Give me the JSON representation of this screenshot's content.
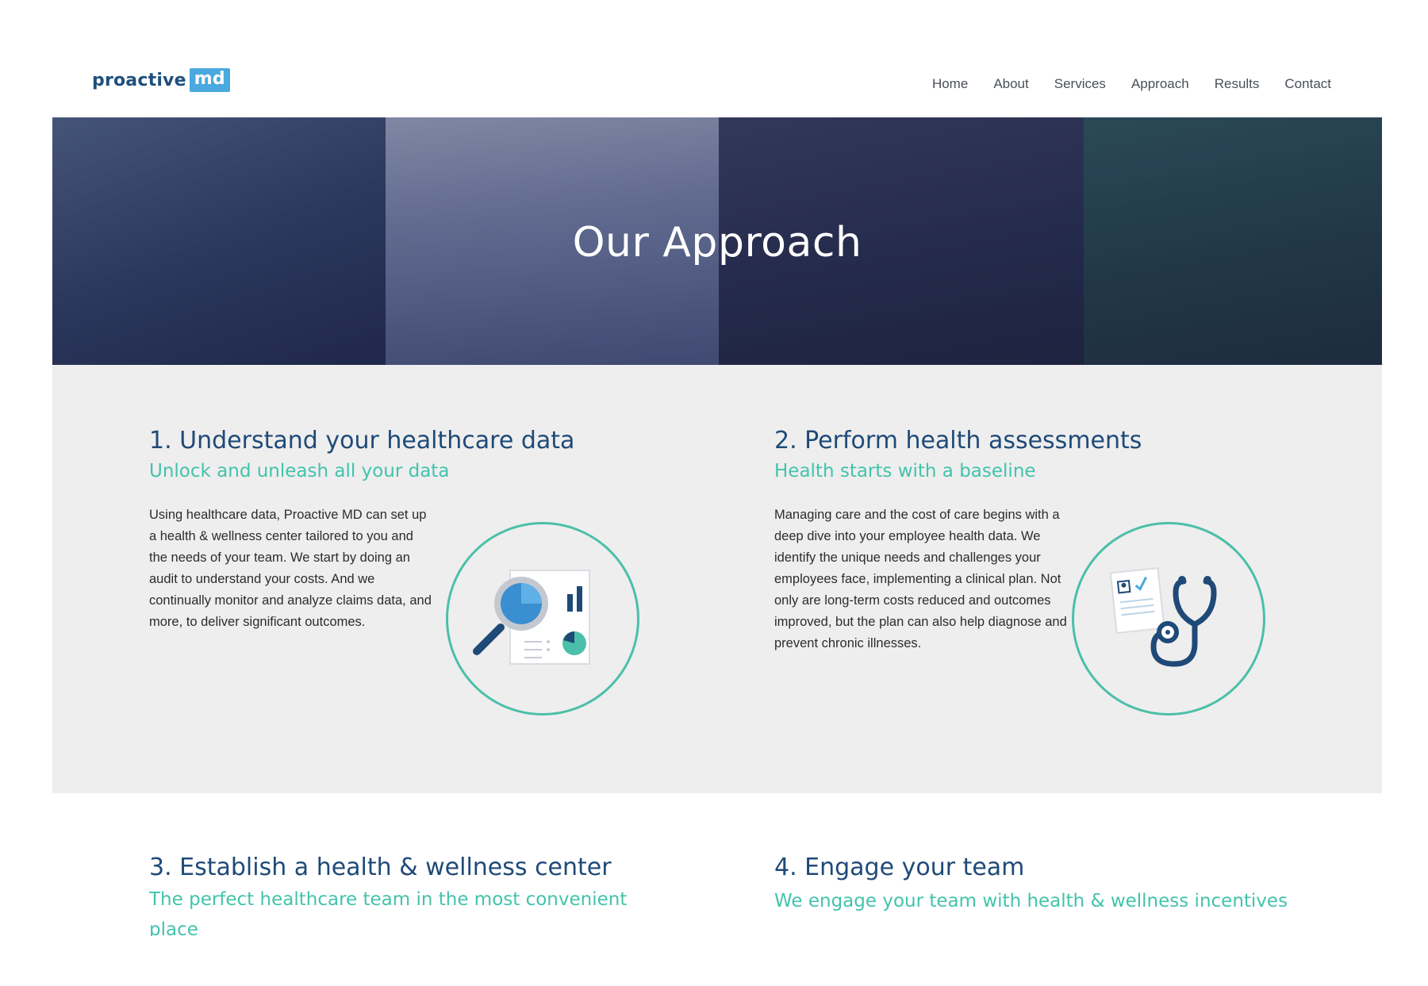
{
  "header": {
    "logo_word": "proactive",
    "logo_badge": "md",
    "nav": [
      "Home",
      "About",
      "Services",
      "Approach",
      "Results",
      "Contact"
    ]
  },
  "hero": {
    "title": "Our Approach"
  },
  "steps": [
    {
      "title": "1. Understand your healthcare data",
      "subtitle": "Unlock and unleash all your data",
      "body": "Using healthcare data, Proactive MD can set up a health & wellness center tailored to you and the needs of your team. We start by doing an audit to understand your costs. And we continually monitor and analyze claims data, and more, to deliver significant outcomes.",
      "icon": "data-analysis-icon"
    },
    {
      "title": "2. Perform health assessments",
      "subtitle": "Health starts with a baseline",
      "body": "Managing care and the cost of care begins with a deep dive into your employee health data. We identify the unique needs and challenges your employees face, implementing a clinical plan. Not only are long-term costs reduced and outcomes improved, but the plan can also help diagnose and prevent chronic illnesses.",
      "icon": "stethoscope-icon"
    },
    {
      "title": "3. Establish a health & wellness center",
      "subtitle": "The perfect healthcare team in the most convenient place"
    },
    {
      "title": "4. Engage your team",
      "subtitle": "We engage your team with health & wellness incentives"
    }
  ],
  "colors": {
    "navy": "#1f4a78",
    "teal": "#43c3ac",
    "logo_blue": "#4aa9de",
    "section_grey": "#eeeeee"
  }
}
